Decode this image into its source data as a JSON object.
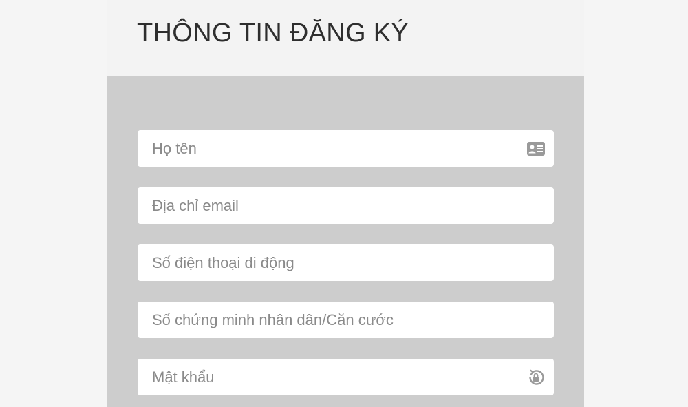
{
  "form": {
    "title": "THÔNG TIN ĐĂNG KÝ",
    "fields": [
      {
        "placeholder": "Họ tên",
        "icon": "id-card-icon"
      },
      {
        "placeholder": "Địa chỉ email",
        "icon": ""
      },
      {
        "placeholder": "Số điện thoại di động",
        "icon": ""
      },
      {
        "placeholder": "Số chứng minh nhân dân/Căn cước",
        "icon": ""
      },
      {
        "placeholder": "Mật khẩu",
        "icon": "lock-icon"
      }
    ]
  },
  "colors": {
    "page_background": "#f5f5f5",
    "header_background": "#f3f3f3",
    "form_background": "#cdcdcd",
    "field_background": "#ffffff",
    "title_text": "#2e2e2e",
    "placeholder_text": "#8a8a8a",
    "icon": "#9a9a9a"
  }
}
